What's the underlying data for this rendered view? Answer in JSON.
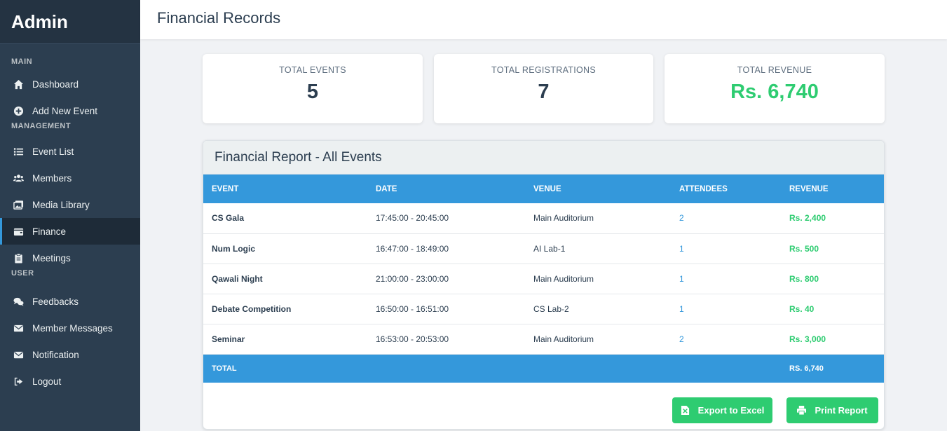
{
  "sidebar": {
    "brand": "Admin",
    "sections": {
      "main": "MAIN",
      "management": "MANAGEMENT",
      "user": "USER"
    },
    "items": [
      {
        "label": "Dashboard",
        "icon": "home-icon"
      },
      {
        "label": "Add New Event",
        "icon": "plus-circle-icon"
      },
      {
        "label": "Event List",
        "icon": "list-icon"
      },
      {
        "label": "Members",
        "icon": "users-icon"
      },
      {
        "label": "Media Library",
        "icon": "images-icon"
      },
      {
        "label": "Finance",
        "icon": "wallet-icon",
        "active": true
      },
      {
        "label": "Meetings",
        "icon": "clipboard-icon"
      },
      {
        "label": "Feedbacks",
        "icon": "comments-icon"
      },
      {
        "label": "Member Messages",
        "icon": "envelope-icon"
      },
      {
        "label": "Notification",
        "icon": "envelope-icon"
      },
      {
        "label": "Logout",
        "icon": "logout-icon"
      }
    ]
  },
  "header": {
    "title": "Financial Records"
  },
  "stats": {
    "events": {
      "label": "TOTAL EVENTS",
      "value": "5"
    },
    "registrations": {
      "label": "TOTAL REGISTRATIONS",
      "value": "7"
    },
    "revenue": {
      "label": "TOTAL REVENUE",
      "value": "Rs. 6,740"
    }
  },
  "report": {
    "title": "Financial Report - All Events",
    "columns": [
      "EVENT",
      "DATE",
      "VENUE",
      "ATTENDEES",
      "REVENUE"
    ],
    "rows": [
      {
        "event": "CS Gala",
        "date": "17:45:00 - 20:45:00",
        "venue": "Main Auditorium",
        "attendees": "2",
        "revenue": "Rs. 2,400"
      },
      {
        "event": "Num Logic",
        "date": "16:47:00 - 18:49:00",
        "venue": "AI Lab-1",
        "attendees": "1",
        "revenue": "Rs. 500"
      },
      {
        "event": "Qawali Night",
        "date": "21:00:00 - 23:00:00",
        "venue": "Main Auditorium",
        "attendees": "1",
        "revenue": "Rs. 800"
      },
      {
        "event": "Debate Competition",
        "date": "16:50:00 - 16:51:00",
        "venue": "CS Lab-2",
        "attendees": "1",
        "revenue": "Rs. 40"
      },
      {
        "event": "Seminar",
        "date": "16:53:00 - 20:53:00",
        "venue": "Main Auditorium",
        "attendees": "2",
        "revenue": "Rs. 3,000"
      }
    ],
    "total_label": "TOTAL",
    "total_value": "RS. 6,740",
    "export_label": "Export to Excel",
    "print_label": "Print Report"
  },
  "colors": {
    "sidebar_bg": "#2c3e50",
    "accent_blue": "#3498db",
    "accent_green": "#2ecc71"
  }
}
